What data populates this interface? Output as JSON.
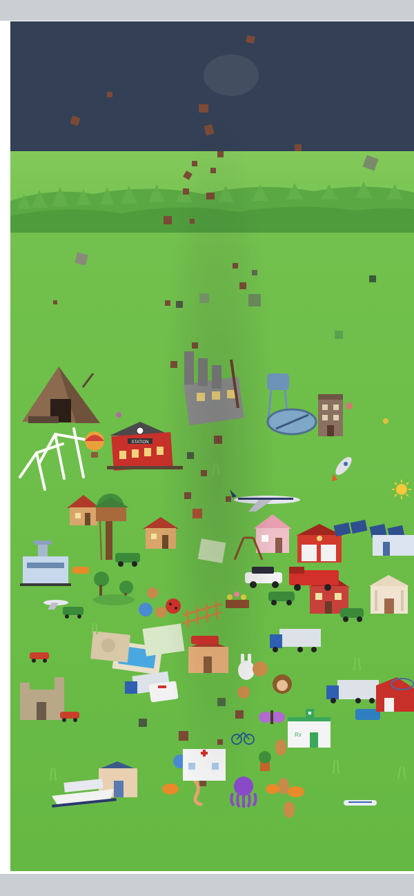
{
  "scene": {
    "colors": {
      "page": "#c9cfd2",
      "sky": "#334055",
      "grass": "#6bbf4a",
      "hills": "#5aa844",
      "debris": "#7a4a36"
    },
    "objects": [
      {
        "name": "pyramid-mine"
      },
      {
        "name": "factory"
      },
      {
        "name": "water-tower"
      },
      {
        "name": "brick-building"
      },
      {
        "name": "wind-turbines"
      },
      {
        "name": "hot-air-balloon"
      },
      {
        "name": "train-station"
      },
      {
        "name": "rocket"
      },
      {
        "name": "sun"
      },
      {
        "name": "airplane"
      },
      {
        "name": "houses"
      },
      {
        "name": "treehouse"
      },
      {
        "name": "fire-station"
      },
      {
        "name": "solar-panels"
      },
      {
        "name": "airport"
      },
      {
        "name": "bank"
      },
      {
        "name": "police-car"
      },
      {
        "name": "fire-truck"
      },
      {
        "name": "swimming-pool"
      },
      {
        "name": "trucks"
      },
      {
        "name": "ambulance"
      },
      {
        "name": "castle"
      },
      {
        "name": "hospital"
      },
      {
        "name": "pharmacy"
      },
      {
        "name": "cruise-ship"
      },
      {
        "name": "bullet-train"
      },
      {
        "name": "animals"
      }
    ]
  },
  "labels": {
    "station_sign": "STATION",
    "pharmacy_sign": "Rx"
  }
}
